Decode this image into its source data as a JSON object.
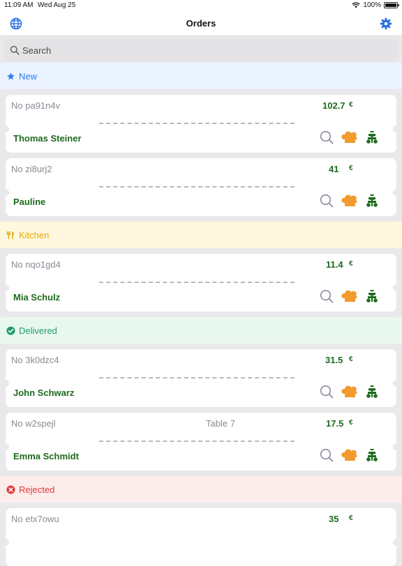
{
  "status_bar": {
    "time": "11:09 AM",
    "date": "Wed Aug 25",
    "battery": "100%",
    "battery_level": 1.0
  },
  "nav": {
    "title": "Orders"
  },
  "search": {
    "placeholder": "Search"
  },
  "colors": {
    "accent": "#2b6fe0",
    "new": "#2f80ed",
    "kitchen": "#e0a800",
    "delivered": "#1f9d6a",
    "rejected": "#e03a3a",
    "green": "#1d6b1d",
    "orange": "#f29a2e"
  },
  "sections": {
    "new": {
      "label": "New",
      "icon": "star-icon"
    },
    "kitchen": {
      "label": "Kitchen",
      "icon": "fork-knife-icon"
    },
    "delivered": {
      "label": "Delivered",
      "icon": "check-circle-icon"
    },
    "rejected": {
      "label": "Rejected",
      "icon": "x-circle-icon"
    }
  },
  "orders": [
    {
      "no": "No pa91n4v",
      "price": "102.7",
      "currency": "€",
      "name": "Thomas Steiner",
      "table": ""
    },
    {
      "no": "No zi8urj2",
      "price": "41",
      "currency": "€",
      "name": "Pauline",
      "table": ""
    },
    {
      "no": "No nqo1gd4",
      "price": "11.4",
      "currency": "€",
      "name": "Mia Schulz",
      "table": ""
    },
    {
      "no": "No 3k0dzc4",
      "price": "31.5",
      "currency": "€",
      "name": "John Schwarz",
      "table": ""
    },
    {
      "no": "No w2spejl",
      "price": "17.5",
      "currency": "€",
      "name": "Emma Schmidt",
      "table": "Table 7"
    },
    {
      "no": "No etx7owu",
      "price": "35",
      "currency": "€",
      "name": "",
      "table": ""
    }
  ]
}
